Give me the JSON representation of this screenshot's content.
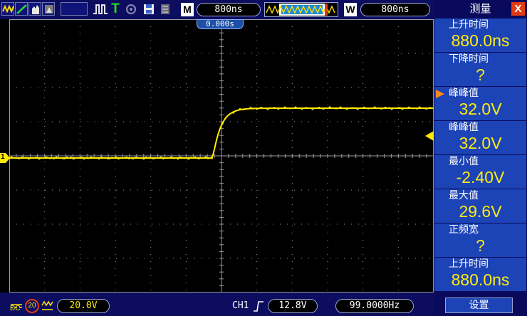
{
  "toolbar": {
    "icons": [
      "waveform-icon",
      "edge-icon",
      "hand-icon",
      "pulse-icon",
      "trigger-icon",
      "save-icon",
      "memory-icon"
    ],
    "trigger_letter": "T",
    "mode_key": "M",
    "timebase": "800ns",
    "window_key": "W",
    "window_timebase": "800ns"
  },
  "plot": {
    "trigger_position": "0.000s",
    "channel_marker": "1",
    "colors": {
      "trace": "#ffea00",
      "grid": "#9a9a9a",
      "background": "#000000"
    }
  },
  "panel": {
    "title": "测量",
    "close_label": "X",
    "measurements": [
      {
        "label": "上升时间",
        "value": "880.0ns",
        "selected": false
      },
      {
        "label": "下降时间",
        "value": "?",
        "selected": false
      },
      {
        "label": "峰峰值",
        "value": "32.0V",
        "selected": true
      },
      {
        "label": "峰峰值",
        "value": "32.0V",
        "selected": false
      },
      {
        "label": "最小值",
        "value": "-2.40V",
        "selected": false
      },
      {
        "label": "最大值",
        "value": "29.6V",
        "selected": false
      },
      {
        "label": "正频宽",
        "value": "?",
        "selected": false
      },
      {
        "label": "上升时间",
        "value": "880.0ns",
        "selected": false
      }
    ],
    "settings_label": "设置"
  },
  "statusbar": {
    "coupling": "DC",
    "bw_limit": "20",
    "volts_div": "20.0V",
    "channel": "CH1",
    "trigger_level": "12.8V",
    "frequency": "99.0000Hz"
  }
}
